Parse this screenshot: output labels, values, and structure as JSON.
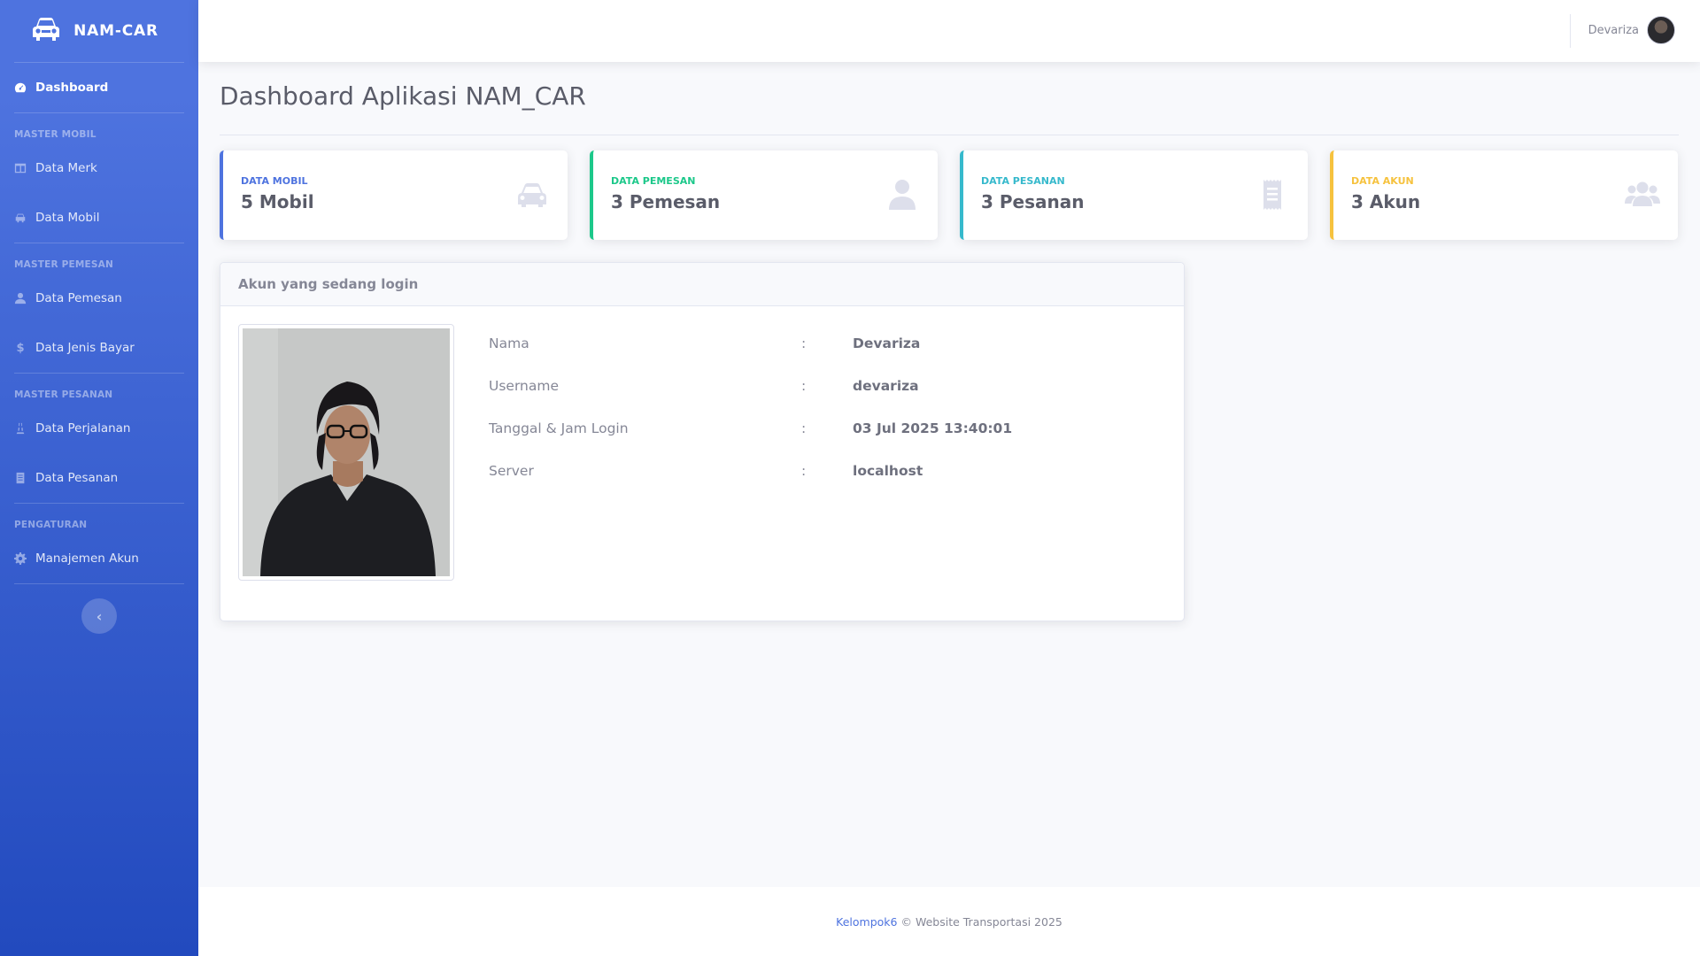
{
  "brand": {
    "name": "NAM-CAR"
  },
  "sidebar": {
    "dashboard": "Dashboard",
    "sections": [
      {
        "heading": "MASTER MOBIL",
        "items": [
          "Data Merk",
          "Data Mobil"
        ]
      },
      {
        "heading": "MASTER PEMESAN",
        "items": [
          "Data Pemesan",
          "Data Jenis Bayar"
        ]
      },
      {
        "heading": "MASTER PESANAN",
        "items": [
          "Data Perjalanan",
          "Data Pesanan"
        ]
      },
      {
        "heading": "PENGATURAN",
        "items": [
          "Manajemen Akun"
        ]
      }
    ]
  },
  "topbar": {
    "user_name": "Devariza"
  },
  "page": {
    "title": "Dashboard Aplikasi NAM_CAR"
  },
  "cards": [
    {
      "label": "DATA MOBIL",
      "value": "5 Mobil",
      "color": "#4e73df",
      "icon": "car-icon"
    },
    {
      "label": "DATA PEMESAN",
      "value": "3 Pemesan",
      "color": "#1cc88a",
      "icon": "user-icon"
    },
    {
      "label": "DATA PESANAN",
      "value": "3 Pesanan",
      "color": "#36b9cc",
      "icon": "receipt-icon"
    },
    {
      "label": "DATA AKUN",
      "value": "3 Akun",
      "color": "#f6c23e",
      "icon": "users-icon"
    }
  ],
  "panel": {
    "title": "Akun yang sedang login",
    "rows": [
      {
        "key": "Nama",
        "colon": ":",
        "value": "Devariza"
      },
      {
        "key": "Username",
        "colon": ":",
        "value": "devariza"
      },
      {
        "key": "Tanggal & Jam Login",
        "colon": ":",
        "value": "03 Jul 2025 13:40:01"
      },
      {
        "key": "Server",
        "colon": ":",
        "value": "localhost"
      }
    ]
  },
  "footer": {
    "link": "Kelompok6",
    "text": "© Website Transportasi 2025"
  }
}
